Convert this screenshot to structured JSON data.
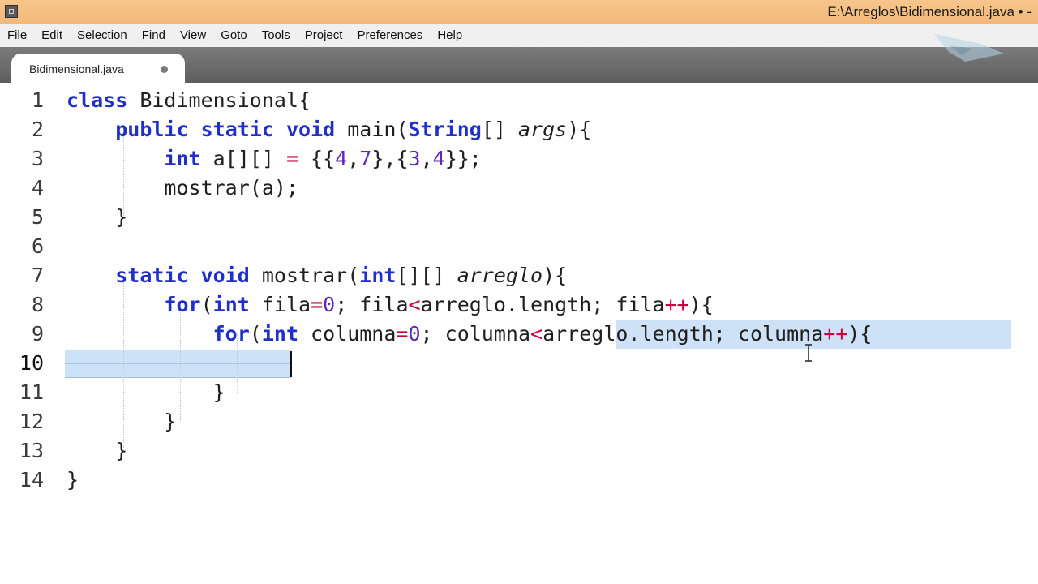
{
  "window": {
    "title": "E:\\Arreglos\\Bidimensional.java • -"
  },
  "menu": [
    "File",
    "Edit",
    "Selection",
    "Find",
    "View",
    "Goto",
    "Tools",
    "Project",
    "Preferences",
    "Help"
  ],
  "tabs": [
    {
      "label": "Bidimensional.java",
      "modified": true
    }
  ],
  "editor": {
    "line_numbers": [
      "1",
      "2",
      "3",
      "4",
      "5",
      "6",
      "7",
      "8",
      "9",
      "10",
      "11",
      "12",
      "13",
      "14"
    ],
    "current_line": "10",
    "code": [
      "class Bidimensional{",
      "    public static void main(String[] args){",
      "        int a[][] = {{4,7},{3,4}};",
      "        mostrar(a);",
      "    }",
      "",
      "    static void mostrar(int[][] arreglo){",
      "        for(int fila=0; fila<arreglo.length; fila++){",
      "            for(int columna=0; columna<arreglo.length; columna++){",
      "",
      "            }",
      "        }",
      "    }",
      "}"
    ]
  },
  "colors": {
    "keyword": "#1f2fc8",
    "number": "#5a2ab8",
    "operator": "#c8003c",
    "selection": "#cde2f6"
  }
}
